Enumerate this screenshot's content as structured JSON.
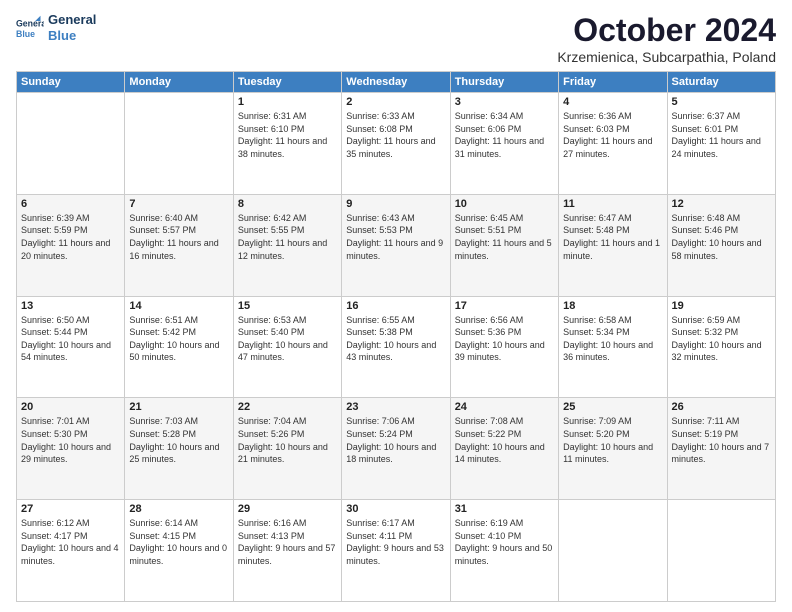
{
  "header": {
    "logo_line1": "General",
    "logo_line2": "Blue",
    "month": "October 2024",
    "location": "Krzemienica, Subcarpathia, Poland"
  },
  "weekdays": [
    "Sunday",
    "Monday",
    "Tuesday",
    "Wednesday",
    "Thursday",
    "Friday",
    "Saturday"
  ],
  "weeks": [
    [
      {
        "day": "",
        "info": ""
      },
      {
        "day": "",
        "info": ""
      },
      {
        "day": "1",
        "info": "Sunrise: 6:31 AM\nSunset: 6:10 PM\nDaylight: 11 hours and 38 minutes."
      },
      {
        "day": "2",
        "info": "Sunrise: 6:33 AM\nSunset: 6:08 PM\nDaylight: 11 hours and 35 minutes."
      },
      {
        "day": "3",
        "info": "Sunrise: 6:34 AM\nSunset: 6:06 PM\nDaylight: 11 hours and 31 minutes."
      },
      {
        "day": "4",
        "info": "Sunrise: 6:36 AM\nSunset: 6:03 PM\nDaylight: 11 hours and 27 minutes."
      },
      {
        "day": "5",
        "info": "Sunrise: 6:37 AM\nSunset: 6:01 PM\nDaylight: 11 hours and 24 minutes."
      }
    ],
    [
      {
        "day": "6",
        "info": "Sunrise: 6:39 AM\nSunset: 5:59 PM\nDaylight: 11 hours and 20 minutes."
      },
      {
        "day": "7",
        "info": "Sunrise: 6:40 AM\nSunset: 5:57 PM\nDaylight: 11 hours and 16 minutes."
      },
      {
        "day": "8",
        "info": "Sunrise: 6:42 AM\nSunset: 5:55 PM\nDaylight: 11 hours and 12 minutes."
      },
      {
        "day": "9",
        "info": "Sunrise: 6:43 AM\nSunset: 5:53 PM\nDaylight: 11 hours and 9 minutes."
      },
      {
        "day": "10",
        "info": "Sunrise: 6:45 AM\nSunset: 5:51 PM\nDaylight: 11 hours and 5 minutes."
      },
      {
        "day": "11",
        "info": "Sunrise: 6:47 AM\nSunset: 5:48 PM\nDaylight: 11 hours and 1 minute."
      },
      {
        "day": "12",
        "info": "Sunrise: 6:48 AM\nSunset: 5:46 PM\nDaylight: 10 hours and 58 minutes."
      }
    ],
    [
      {
        "day": "13",
        "info": "Sunrise: 6:50 AM\nSunset: 5:44 PM\nDaylight: 10 hours and 54 minutes."
      },
      {
        "day": "14",
        "info": "Sunrise: 6:51 AM\nSunset: 5:42 PM\nDaylight: 10 hours and 50 minutes."
      },
      {
        "day": "15",
        "info": "Sunrise: 6:53 AM\nSunset: 5:40 PM\nDaylight: 10 hours and 47 minutes."
      },
      {
        "day": "16",
        "info": "Sunrise: 6:55 AM\nSunset: 5:38 PM\nDaylight: 10 hours and 43 minutes."
      },
      {
        "day": "17",
        "info": "Sunrise: 6:56 AM\nSunset: 5:36 PM\nDaylight: 10 hours and 39 minutes."
      },
      {
        "day": "18",
        "info": "Sunrise: 6:58 AM\nSunset: 5:34 PM\nDaylight: 10 hours and 36 minutes."
      },
      {
        "day": "19",
        "info": "Sunrise: 6:59 AM\nSunset: 5:32 PM\nDaylight: 10 hours and 32 minutes."
      }
    ],
    [
      {
        "day": "20",
        "info": "Sunrise: 7:01 AM\nSunset: 5:30 PM\nDaylight: 10 hours and 29 minutes."
      },
      {
        "day": "21",
        "info": "Sunrise: 7:03 AM\nSunset: 5:28 PM\nDaylight: 10 hours and 25 minutes."
      },
      {
        "day": "22",
        "info": "Sunrise: 7:04 AM\nSunset: 5:26 PM\nDaylight: 10 hours and 21 minutes."
      },
      {
        "day": "23",
        "info": "Sunrise: 7:06 AM\nSunset: 5:24 PM\nDaylight: 10 hours and 18 minutes."
      },
      {
        "day": "24",
        "info": "Sunrise: 7:08 AM\nSunset: 5:22 PM\nDaylight: 10 hours and 14 minutes."
      },
      {
        "day": "25",
        "info": "Sunrise: 7:09 AM\nSunset: 5:20 PM\nDaylight: 10 hours and 11 minutes."
      },
      {
        "day": "26",
        "info": "Sunrise: 7:11 AM\nSunset: 5:19 PM\nDaylight: 10 hours and 7 minutes."
      }
    ],
    [
      {
        "day": "27",
        "info": "Sunrise: 6:12 AM\nSunset: 4:17 PM\nDaylight: 10 hours and 4 minutes."
      },
      {
        "day": "28",
        "info": "Sunrise: 6:14 AM\nSunset: 4:15 PM\nDaylight: 10 hours and 0 minutes."
      },
      {
        "day": "29",
        "info": "Sunrise: 6:16 AM\nSunset: 4:13 PM\nDaylight: 9 hours and 57 minutes."
      },
      {
        "day": "30",
        "info": "Sunrise: 6:17 AM\nSunset: 4:11 PM\nDaylight: 9 hours and 53 minutes."
      },
      {
        "day": "31",
        "info": "Sunrise: 6:19 AM\nSunset: 4:10 PM\nDaylight: 9 hours and 50 minutes."
      },
      {
        "day": "",
        "info": ""
      },
      {
        "day": "",
        "info": ""
      }
    ]
  ]
}
